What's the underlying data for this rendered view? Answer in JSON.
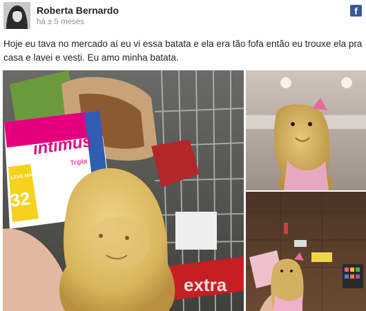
{
  "post": {
    "author_name": "Roberta Bernardo",
    "timestamp": "há ± 5 meses",
    "text": "Hoje eu tava no mercado aí eu vi essa batata e ela era tão fofa então eu trouxe ela pra casa e lavei e vesti. Eu amo minha batata."
  },
  "icons": {
    "network": "facebook-icon",
    "network_glyph": "f"
  },
  "photos": {
    "main": {
      "pack_brand": "intimus",
      "pack_count": "32",
      "pack_promo": "LEVE MAIS PAGUE MENOS",
      "pack_variant": "Tripla",
      "cart_handle_text": "extra"
    }
  },
  "colors": {
    "facebook_blue": "#3b5998",
    "text": "#1d2129",
    "meta": "#90949c"
  }
}
